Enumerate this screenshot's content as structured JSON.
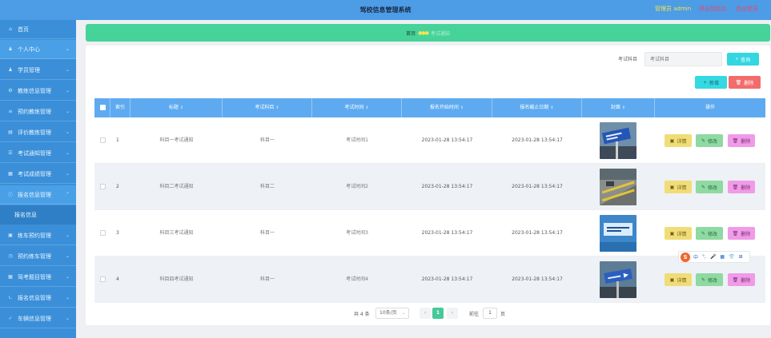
{
  "header": {
    "title": "驾校信息管理系统",
    "user": "管理员 admin",
    "back_label": "退出到前台",
    "logout_label": "退出登录"
  },
  "sidebar": {
    "items": [
      {
        "label": "首页",
        "icon": "home-icon"
      },
      {
        "label": "个人中心",
        "icon": "user-icon"
      },
      {
        "label": "学员管理",
        "icon": "user-icon"
      },
      {
        "label": "教练信息管理",
        "icon": "gear-icon"
      },
      {
        "label": "预约教练管理",
        "icon": "list-icon"
      },
      {
        "label": "评价教练管理",
        "icon": "document-icon"
      },
      {
        "label": "考试通知管理",
        "icon": "menu-icon"
      },
      {
        "label": "考试成绩管理",
        "icon": "document-icon"
      },
      {
        "label": "报名信息管理",
        "icon": "info-icon"
      },
      {
        "label": "报名信息",
        "icon": ""
      },
      {
        "label": "练车预约管理",
        "icon": "calendar-icon"
      },
      {
        "label": "预约练车管理",
        "icon": "calendar-icon"
      },
      {
        "label": "驾考题目管理",
        "icon": "document-icon"
      },
      {
        "label": "报名信息管理",
        "icon": "info-icon"
      },
      {
        "label": "车辆信息管理",
        "icon": "car-icon"
      }
    ]
  },
  "breadcrumb": {
    "home": "首页",
    "current": "考试通知"
  },
  "search": {
    "label": "考试科目",
    "placeholder": "考试科目",
    "button": "查询"
  },
  "actions": {
    "add": "新增",
    "delete": "删除"
  },
  "table": {
    "columns": [
      "索引",
      "标题",
      "考试科目",
      "考试时间",
      "报名开始时间",
      "报名截止日期",
      "封面",
      "操作"
    ],
    "rows": [
      {
        "index": "1",
        "title": "科目一考试通知",
        "subject": "科目一",
        "exam_time": "考试时间1",
        "start": "2023-01-28 13:54:17",
        "end": "2023-01-28 13:54:17"
      },
      {
        "index": "2",
        "title": "科目二考试通知",
        "subject": "科目二",
        "exam_time": "考试时间2",
        "start": "2023-01-28 13:54:17",
        "end": "2023-01-28 13:54:17"
      },
      {
        "index": "3",
        "title": "科目三考试通知",
        "subject": "科目一",
        "exam_time": "考试时间3",
        "start": "2023-01-28 13:54:17",
        "end": "2023-01-28 13:54:17"
      },
      {
        "index": "4",
        "title": "科目四考试通知",
        "subject": "科目一",
        "exam_time": "考试时间4",
        "start": "2023-01-28 13:54:17",
        "end": "2023-01-28 13:54:17"
      }
    ],
    "ops": {
      "detail": "详情",
      "edit": "修改",
      "remove": "删除"
    }
  },
  "pagination": {
    "total": "共 4 条",
    "page_size": "10条/页",
    "current_page": "1",
    "goto_label": "前往",
    "goto_value": "1",
    "unit": "页"
  },
  "ime": {
    "items": [
      "中",
      "°,",
      "🎤",
      "▦",
      "👕",
      "⊞"
    ]
  },
  "colors": {
    "topbar": "#4c9ce6",
    "sidebar": "#3a8fd8",
    "breadcrumb": "#46d39a",
    "table_header": "#5eaaf0"
  }
}
